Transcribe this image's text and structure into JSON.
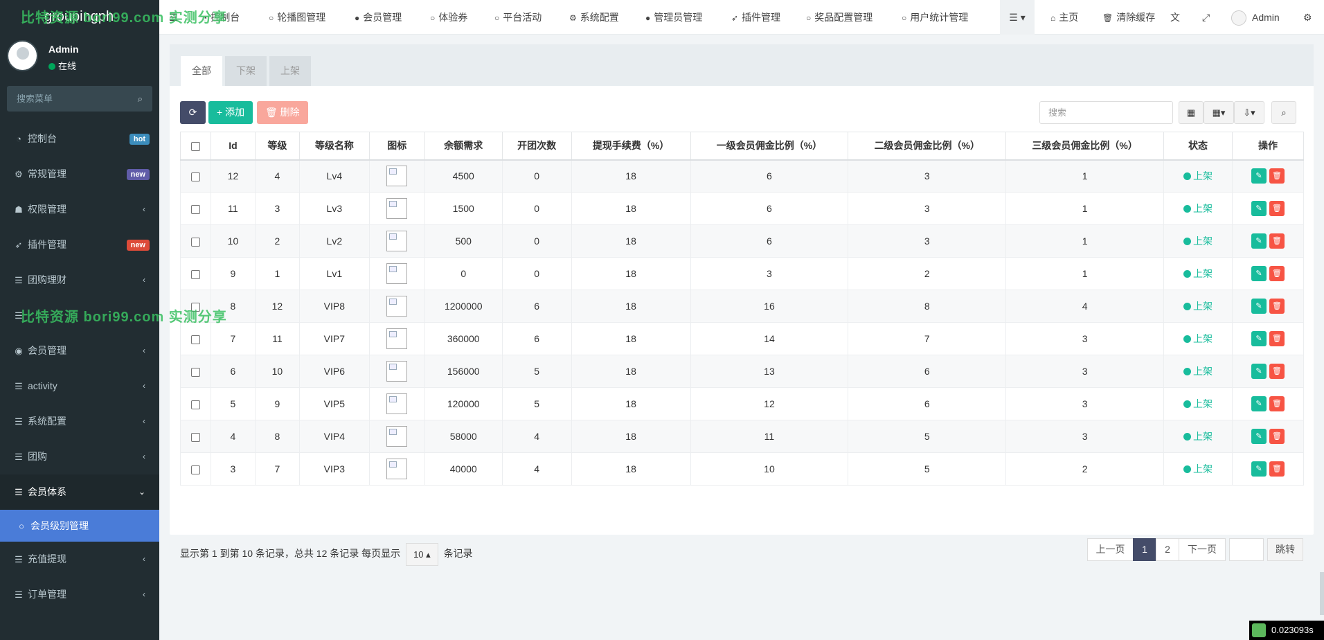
{
  "brand": "groupingph",
  "watermark": "比特资源 bori99.com 实测分享",
  "user": {
    "name": "Admin",
    "status": "在线"
  },
  "side_search_placeholder": "搜索菜单",
  "sidebar": [
    {
      "label": "控制台",
      "badge": "hot",
      "badge_color": "#3c8dbc"
    },
    {
      "label": "常规管理",
      "badge": "new",
      "badge_color": "#605ca8"
    },
    {
      "label": "权限管理",
      "arrow": "‹"
    },
    {
      "label": "插件管理",
      "badge": "new",
      "badge_color": "#dd4b39"
    },
    {
      "label": "团购理财",
      "arrow": "‹"
    },
    {
      "label": "",
      "arrow": ""
    },
    {
      "label": "会员管理",
      "arrow": "‹"
    },
    {
      "label": "activity",
      "arrow": "‹"
    },
    {
      "label": "系统配置",
      "arrow": "‹"
    },
    {
      "label": "团购",
      "arrow": "‹"
    },
    {
      "label": "会员体系",
      "arrow": "⌄"
    },
    {
      "label": "会员级别管理"
    },
    {
      "label": "充值提现",
      "arrow": "‹"
    },
    {
      "label": "订单管理",
      "arrow": "‹"
    }
  ],
  "topnav": [
    "控制台",
    "轮播图管理",
    "会员管理",
    "体验券",
    "平台活动",
    "系统配置",
    "管理员管理",
    "插件管理",
    "奖品配置管理",
    "用户统计管理"
  ],
  "topright": {
    "home": "主页",
    "clear_cache": "清除缓存",
    "admin": "Admin"
  },
  "tabs": [
    "全部",
    "下架",
    "上架"
  ],
  "toolbar": {
    "add": "添加",
    "delete": "删除",
    "search_placeholder": "搜索"
  },
  "table": {
    "headers": [
      "Id",
      "等级",
      "等级名称",
      "图标",
      "余额需求",
      "开团次数",
      "提现手续费（%）",
      "一级会员佣金比例（%）",
      "二级会员佣金比例（%）",
      "三级会员佣金比例（%）",
      "状态",
      "操作"
    ],
    "rows": [
      [
        "12",
        "4",
        "Lv4",
        "4500",
        "0",
        "18",
        "6",
        "3",
        "1",
        "上架"
      ],
      [
        "11",
        "3",
        "Lv3",
        "1500",
        "0",
        "18",
        "6",
        "3",
        "1",
        "上架"
      ],
      [
        "10",
        "2",
        "Lv2",
        "500",
        "0",
        "18",
        "6",
        "3",
        "1",
        "上架"
      ],
      [
        "9",
        "1",
        "Lv1",
        "0",
        "0",
        "18",
        "3",
        "2",
        "1",
        "上架"
      ],
      [
        "8",
        "12",
        "VIP8",
        "1200000",
        "6",
        "18",
        "16",
        "8",
        "4",
        "上架"
      ],
      [
        "7",
        "11",
        "VIP7",
        "360000",
        "6",
        "18",
        "14",
        "7",
        "3",
        "上架"
      ],
      [
        "6",
        "10",
        "VIP6",
        "156000",
        "5",
        "18",
        "13",
        "6",
        "3",
        "上架"
      ],
      [
        "5",
        "9",
        "VIP5",
        "120000",
        "5",
        "18",
        "12",
        "6",
        "3",
        "上架"
      ],
      [
        "4",
        "8",
        "VIP4",
        "58000",
        "4",
        "18",
        "11",
        "5",
        "3",
        "上架"
      ],
      [
        "3",
        "7",
        "VIP3",
        "40000",
        "4",
        "18",
        "10",
        "5",
        "2",
        "上架"
      ]
    ]
  },
  "footer": {
    "summary": "显示第 1 到第 10 条记录，总共 12 条记录 每页显示",
    "page_size": "10",
    "suffix": "条记录",
    "prev": "上一页",
    "pages": [
      "1",
      "2"
    ],
    "next": "下一页",
    "jump": "跳转"
  },
  "timer": "0.023093s",
  "colors": {
    "sidebar_bg": "#222d32",
    "active_sub": "#4a7cd8",
    "primary": "#18bc9c",
    "danger": "#f75444",
    "dark_btn": "#444c69"
  }
}
